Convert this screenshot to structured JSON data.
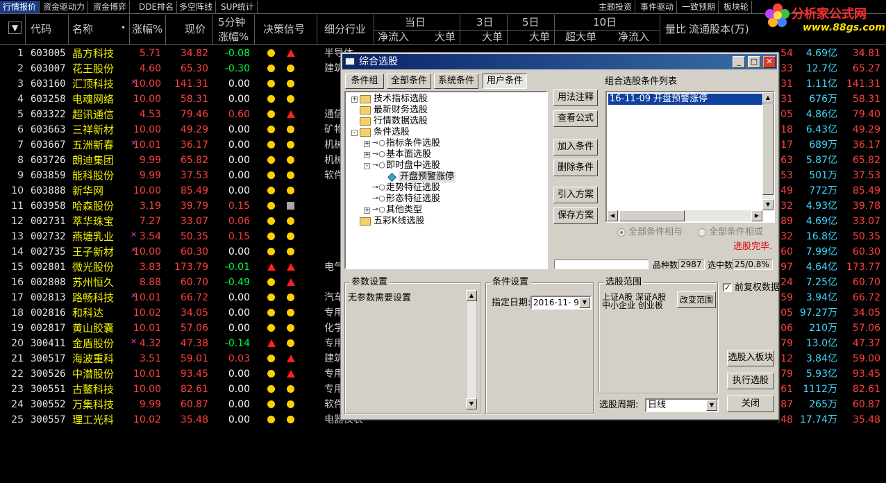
{
  "top_tabs": [
    {
      "label": "行情报价",
      "active": true
    },
    {
      "label": "资金驱动力"
    },
    {
      "label": "资金博弈"
    },
    {
      "label": "DDE排名"
    },
    {
      "label": "多空阵线"
    },
    {
      "label": "SUP统计"
    },
    {
      "label": "主题投资"
    },
    {
      "label": "事件驱动"
    },
    {
      "label": "一致预期"
    },
    {
      "label": "板块轮"
    }
  ],
  "logo": {
    "title": "分析家公式网",
    "url": "www.88gs.com"
  },
  "columns": {
    "menu": "▼",
    "code": "代码",
    "name": "名称",
    "dot": "•",
    "pct": "涨幅%",
    "price": "现价",
    "five_min_top": "5分钟",
    "five_min_bottom": "涨幅%",
    "signal": "决策信号",
    "industry": "细分行业",
    "today": "当日",
    "net_in": "净流入",
    "big1": "大单",
    "three_day": "3日",
    "big2": "大单",
    "five_day": "5日",
    "big3": "大单",
    "ten_day": "10日",
    "super_big": "超大单",
    "net_in2": "净流入",
    "vol_ratio": "量比",
    "float_cap": "流通股本(万)"
  },
  "rows": [
    {
      "no": "1",
      "code": "603005",
      "name": "晶方科技",
      "mark": "",
      "pct": "5.71",
      "price": "34.82",
      "five": "-0.08",
      "five_sign": "neg",
      "sig1": "dot",
      "sig2": "tri",
      "ind": "半导体",
      "r1": ".54",
      "cap": "4.69亿",
      "last": "34.81"
    },
    {
      "no": "2",
      "code": "603007",
      "name": "花王股份",
      "mark": "",
      "pct": "4.60",
      "price": "65.30",
      "five": "-0.30",
      "five_sign": "neg",
      "sig1": "dot",
      "sig2": "dot",
      "ind": "建筑",
      "r1": ".33",
      "cap": "12.7亿",
      "last": "65.27"
    },
    {
      "no": "3",
      "code": "603160",
      "name": "汇顶科技",
      "mark": "×",
      "pct": "10.00",
      "price": "141.31",
      "five": "0.00",
      "five_sign": "zero",
      "sig1": "dot",
      "sig2": "dot",
      "ind": "",
      "r1": ".31",
      "cap": "1.11亿",
      "last": "141.31"
    },
    {
      "no": "4",
      "code": "603258",
      "name": "电魂网络",
      "mark": "",
      "pct": "10.00",
      "price": "58.31",
      "five": "0.00",
      "five_sign": "zero",
      "sig1": "dot",
      "sig2": "dot",
      "ind": "",
      "r1": ".31",
      "cap": "676万",
      "last": "58.31"
    },
    {
      "no": "5",
      "code": "603322",
      "name": "超讯通信",
      "mark": "",
      "pct": "4.53",
      "price": "79.46",
      "five": "0.60",
      "five_sign": "pos",
      "sig1": "dot",
      "sig2": "tri",
      "ind": "通信",
      "r1": ".05",
      "cap": "4.86亿",
      "last": "79.40"
    },
    {
      "no": "6",
      "code": "603663",
      "name": "三祥新材",
      "mark": "",
      "pct": "10.00",
      "price": "49.29",
      "five": "0.00",
      "five_sign": "zero",
      "sig1": "dot",
      "sig2": "dot",
      "ind": "矿物",
      "r1": ".18",
      "cap": "6.43亿",
      "last": "49.29"
    },
    {
      "no": "7",
      "code": "603667",
      "name": "五洲新春",
      "mark": "×",
      "pct": "10.01",
      "price": "36.17",
      "five": "0.00",
      "five_sign": "zero",
      "sig1": "dot",
      "sig2": "dot",
      "ind": "机械",
      "r1": ".17",
      "cap": "689万",
      "last": "36.17"
    },
    {
      "no": "8",
      "code": "603726",
      "name": "朗迪集团",
      "mark": "",
      "pct": "9.99",
      "price": "65.82",
      "five": "0.00",
      "five_sign": "zero",
      "sig1": "dot",
      "sig2": "dot",
      "ind": "机械",
      "r1": ".63",
      "cap": "5.87亿",
      "last": "65.82"
    },
    {
      "no": "9",
      "code": "603859",
      "name": "能科股份",
      "mark": "",
      "pct": "9.99",
      "price": "37.53",
      "five": "0.00",
      "five_sign": "zero",
      "sig1": "dot",
      "sig2": "dot",
      "ind": "软件",
      "r1": ".53",
      "cap": "501万",
      "last": "37.53"
    },
    {
      "no": "10",
      "code": "603888",
      "name": "新华网",
      "mark": "",
      "pct": "10.00",
      "price": "85.49",
      "five": "0.00",
      "five_sign": "zero",
      "sig1": "dot",
      "sig2": "dot",
      "ind": "",
      "r1": ".49",
      "cap": "772万",
      "last": "85.49"
    },
    {
      "no": "11",
      "code": "603958",
      "name": "哈森股份",
      "mark": "",
      "pct": "3.19",
      "price": "39.79",
      "five": "0.15",
      "five_sign": "pos",
      "sig1": "dot",
      "sig2": "sq",
      "ind": "",
      "r1": ".32",
      "cap": "4.93亿",
      "last": "39.78"
    },
    {
      "no": "12",
      "code": "002731",
      "name": "萃华珠宝",
      "mark": "",
      "pct": "7.27",
      "price": "33.07",
      "five": "0.06",
      "five_sign": "pos",
      "sig1": "dot",
      "sig2": "dot",
      "ind": "",
      "r1": ".89",
      "cap": "4.69亿",
      "last": "33.07"
    },
    {
      "no": "13",
      "code": "002732",
      "name": "燕塘乳业",
      "mark": "×",
      "pct": "3.54",
      "price": "50.35",
      "five": "0.15",
      "five_sign": "pos",
      "sig1": "dot",
      "sig2": "dot",
      "ind": "",
      "r1": ".32",
      "cap": "16.8亿",
      "last": "50.35"
    },
    {
      "no": "14",
      "code": "002735",
      "name": "王子新材",
      "mark": "×",
      "pct": "10.00",
      "price": "60.30",
      "five": "0.00",
      "five_sign": "zero",
      "sig1": "dot",
      "sig2": "dot",
      "ind": "",
      "r1": ".60",
      "cap": "7.99亿",
      "last": "60.30"
    },
    {
      "no": "15",
      "code": "002801",
      "name": "微光股份",
      "mark": "",
      "pct": "3.83",
      "price": "173.79",
      "five": "-0.01",
      "five_sign": "neg",
      "sig1": "tri",
      "sig2": "tri",
      "ind": "电气",
      "r1": ".97",
      "cap": "4.64亿",
      "last": "173.77"
    },
    {
      "no": "16",
      "code": "002808",
      "name": "苏州恒久",
      "mark": "",
      "pct": "8.88",
      "price": "60.70",
      "five": "-0.49",
      "five_sign": "neg",
      "sig1": "dot",
      "sig2": "tri",
      "ind": "",
      "r1": ".24",
      "cap": "7.25亿",
      "last": "60.70"
    },
    {
      "no": "17",
      "code": "002813",
      "name": "路畅科技",
      "mark": "×",
      "pct": "10.01",
      "price": "66.72",
      "five": "0.00",
      "five_sign": "zero",
      "sig1": "dot",
      "sig2": "dot",
      "ind": "汽车",
      "r1": ".59",
      "cap": "3.94亿",
      "last": "66.72"
    },
    {
      "no": "18",
      "code": "002816",
      "name": "和科达",
      "mark": "",
      "pct": "10.02",
      "price": "34.05",
      "five": "0.00",
      "five_sign": "zero",
      "sig1": "dot",
      "sig2": "dot",
      "ind": "专用",
      "r1": ".05",
      "cap": "97.27万",
      "last": "34.05"
    },
    {
      "no": "19",
      "code": "002817",
      "name": "黄山胶囊",
      "mark": "",
      "pct": "10.01",
      "price": "57.06",
      "five": "0.00",
      "five_sign": "zero",
      "sig1": "dot",
      "sig2": "dot",
      "ind": "化学",
      "r1": ".06",
      "cap": "210万",
      "last": "57.06"
    },
    {
      "no": "20",
      "code": "300411",
      "name": "金盾股份",
      "mark": "×",
      "pct": "4.32",
      "price": "47.38",
      "five": "-0.14",
      "five_sign": "neg",
      "sig1": "tri",
      "sig2": "dot",
      "ind": "专用",
      "r1": ".79",
      "cap": "13.0亿",
      "last": "47.37"
    },
    {
      "no": "21",
      "code": "300517",
      "name": "海波重科",
      "mark": "",
      "pct": "3.51",
      "price": "59.01",
      "five": "0.03",
      "five_sign": "pos",
      "sig1": "dot",
      "sig2": "tri",
      "ind": "建筑",
      "r1": ".12",
      "cap": "3.84亿",
      "last": "59.00"
    },
    {
      "no": "22",
      "code": "300526",
      "name": "中潜股份",
      "mark": "",
      "pct": "10.01",
      "price": "93.45",
      "five": "0.00",
      "five_sign": "zero",
      "sig1": "dot",
      "sig2": "tri",
      "ind": "专用",
      "r1": ".79",
      "cap": "5.93亿",
      "last": "93.45"
    },
    {
      "no": "23",
      "code": "300551",
      "name": "古鳌科技",
      "mark": "",
      "pct": "10.00",
      "price": "82.61",
      "five": "0.00",
      "five_sign": "zero",
      "sig1": "dot",
      "sig2": "dot",
      "ind": "专用",
      "r1": ".61",
      "cap": "1112万",
      "last": "82.61"
    },
    {
      "no": "24",
      "code": "300552",
      "name": "万集科技",
      "mark": "",
      "pct": "9.99",
      "price": "60.87",
      "five": "0.00",
      "five_sign": "zero",
      "sig1": "dot",
      "sig2": "dot",
      "ind": "软件",
      "r1": ".87",
      "cap": "265万",
      "last": "60.87"
    },
    {
      "no": "25",
      "code": "300557",
      "name": "理工光科",
      "mark": "",
      "pct": "10.02",
      "price": "35.48",
      "five": "0.00",
      "five_sign": "zero",
      "sig1": "dot",
      "sig2": "dot",
      "ind": "电器仪表",
      "r1": ".48",
      "cap": "17.74万",
      "last": "35.48"
    }
  ],
  "dialog": {
    "title": "综合选股",
    "tabs": [
      "条件组",
      "全部条件",
      "系统条件",
      "用户条件"
    ],
    "active_tab": 3,
    "tree": [
      {
        "label": "技术指标选股",
        "level": 0,
        "icon": "folder",
        "expander": "+"
      },
      {
        "label": "最新财务选股",
        "level": 0,
        "icon": "folder",
        "expander": ""
      },
      {
        "label": "行情数据选股",
        "level": 0,
        "icon": "folder",
        "expander": ""
      },
      {
        "label": "条件选股",
        "level": 0,
        "icon": "folder",
        "expander": "-"
      },
      {
        "label": "指标条件选股",
        "level": 1,
        "icon": "key",
        "expander": "+"
      },
      {
        "label": "基本面选股",
        "level": 1,
        "icon": "key",
        "expander": "+"
      },
      {
        "label": "即时盘中选股",
        "level": 1,
        "icon": "key",
        "expander": "-"
      },
      {
        "label": "开盘预警涨停",
        "level": 2,
        "icon": "gem",
        "expander": "",
        "selected": true
      },
      {
        "label": "走势特征选股",
        "level": 1,
        "icon": "key",
        "expander": ""
      },
      {
        "label": "形态特征选股",
        "level": 1,
        "icon": "key",
        "expander": ""
      },
      {
        "label": "其他类型",
        "level": 1,
        "icon": "key",
        "expander": "+"
      },
      {
        "label": "五彩K线选股",
        "level": 0,
        "icon": "folder",
        "expander": ""
      }
    ],
    "buttons": {
      "usage": "用法注释",
      "view_formula": "查看公式",
      "add_condition": "加入条件",
      "delete_condition": "删除条件",
      "import_plan": "引入方案",
      "save_plan": "保存方案",
      "to_block": "选股入板块",
      "execute": "执行选股",
      "close": "关闭",
      "change_range": "改变范围"
    },
    "list_title": "组合选股条件列表",
    "list_items": [
      "16-11-09 开盘预警涨停"
    ],
    "radio_and": "全部条件相与",
    "radio_or": "全部条件相或",
    "status": "选股完毕.",
    "count_label": "品种数",
    "count_value": "2987",
    "hit_label": "选中数",
    "hit_value": "25/0.8%",
    "param_title": "参数设置",
    "param_text": "无参数需要设置",
    "cond_title": "条件设置",
    "date_label": "指定日期:",
    "date_value": "2016-11- 9",
    "range_title": "选股范围",
    "range_line1": "上证A股 深证A股",
    "range_line2": "中小企业 创业板",
    "fq_label": "前复权数据",
    "fq_checked": true,
    "period_label": "选股周期:",
    "period_value": "日线"
  }
}
